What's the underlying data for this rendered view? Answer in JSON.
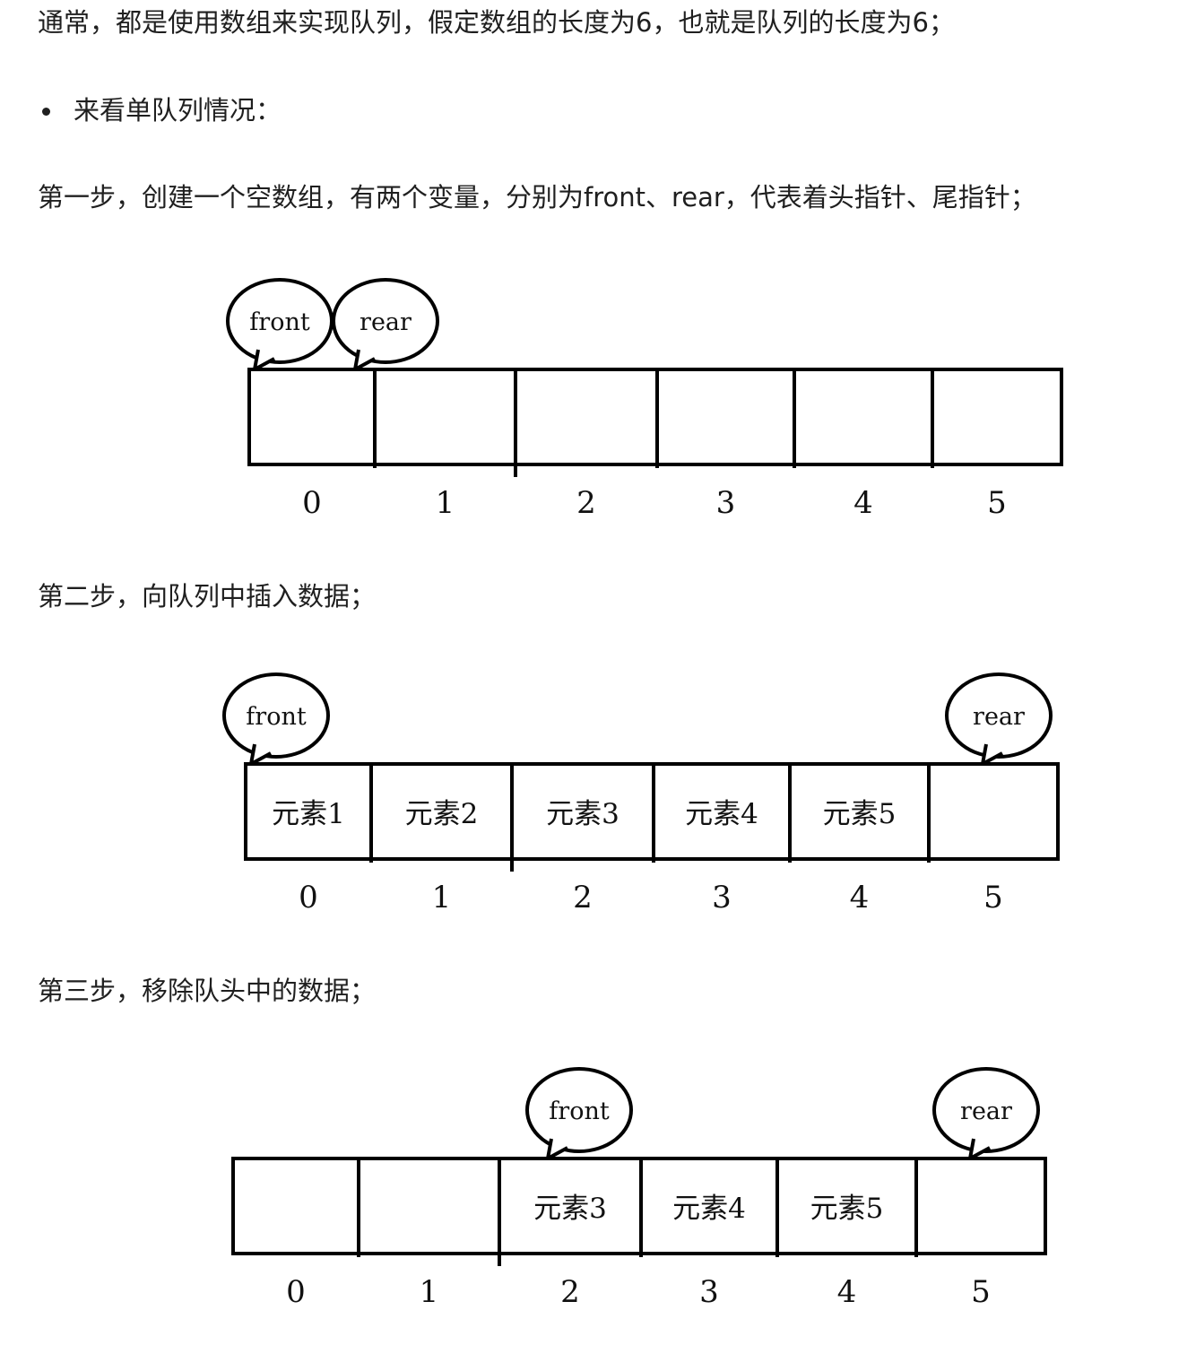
{
  "paragraphs": {
    "intro": "通常，都是使用数组来实现队列，假定数组的长度为6，也就是队列的长度为6；",
    "bullet": "来看单队列情况：",
    "step1": "第一步，创建一个空数组，有两个变量，分别为front、rear，代表着头指针、尾指针；",
    "step2": "第二步，向队列中插入数据；",
    "step3": "第三步，移除队头中的数据；"
  },
  "diagrams": [
    {
      "cells": [
        "",
        "",
        "",
        "",
        "",
        ""
      ],
      "indices": [
        "0",
        "1",
        "2",
        "3",
        "4",
        "5"
      ],
      "pointers": [
        {
          "label": "front",
          "cell": 0
        },
        {
          "label": "rear",
          "cell": 1
        }
      ]
    },
    {
      "cells": [
        "元素1",
        "元素2",
        "元素3",
        "元素4",
        "元素5",
        ""
      ],
      "indices": [
        "0",
        "1",
        "2",
        "3",
        "4",
        "5"
      ],
      "pointers": [
        {
          "label": "front",
          "cell": 0
        },
        {
          "label": "rear",
          "cell": 5
        }
      ]
    },
    {
      "cells": [
        "",
        "",
        "元素3",
        "元素4",
        "元素5",
        ""
      ],
      "indices": [
        "0",
        "1",
        "2",
        "3",
        "4",
        "5"
      ],
      "pointers": [
        {
          "label": "front",
          "cell": 2
        },
        {
          "label": "rear",
          "cell": 5
        }
      ]
    }
  ]
}
